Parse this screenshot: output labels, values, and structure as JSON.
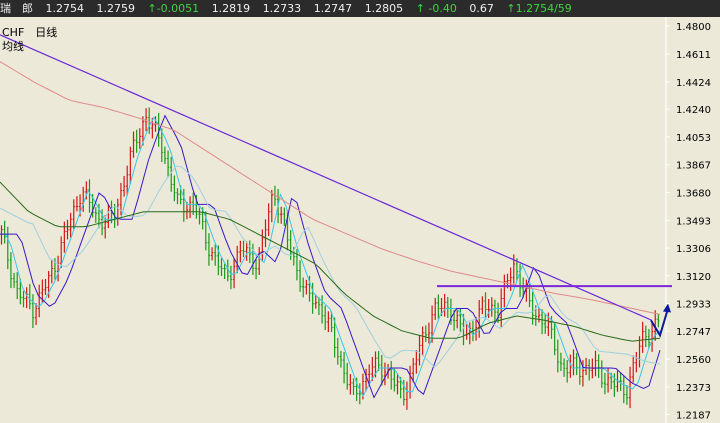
{
  "quote_bar": {
    "name": "瑞　郎",
    "fields": [
      "1.2754",
      "1.2759",
      "0.0051",
      "1.2819",
      "1.2733",
      "1.2747",
      "1.2805"
    ],
    "change_up": "↑-0.0051",
    "change_pct": "↑ -0.40",
    "extra": "0.67",
    "last": "↑1.2754/59"
  },
  "chart_info": {
    "symbol_period": "CHF　日线",
    "indicator": "均线"
  },
  "colors": {
    "background": "#ece9d8",
    "axis": "#ffffff",
    "candle_up": "#d01818",
    "candle_down": "#1a9a1a",
    "ma_fast": "#38c8e8",
    "ma_mid": "#3818c8",
    "ma_light": "#9fd0e0",
    "ma_slow": "#2a6a1a",
    "ma_long": "#e08a8a",
    "trendline": "#6a28d8",
    "resistance": "#7a28d8",
    "arrow": "#0a1a9a"
  },
  "chart_data": {
    "type": "candlestick",
    "title": "CHF 日线",
    "y_ticks": [
      "1.4800",
      "1.4611",
      "1.4424",
      "1.4240",
      "1.4053",
      "1.3867",
      "1.3680",
      "1.3493",
      "1.3306",
      "1.3120",
      "1.2933",
      "1.2747",
      "1.2560",
      "1.2373",
      "1.2187"
    ],
    "ylim": [
      1.213,
      1.486
    ],
    "close_path": [
      1.34,
      1.3,
      1.29,
      1.31,
      1.34,
      1.37,
      1.35,
      1.35,
      1.39,
      1.42,
      1.4,
      1.36,
      1.36,
      1.33,
      1.31,
      1.33,
      1.32,
      1.37,
      1.33,
      1.3,
      1.29,
      1.26,
      1.23,
      1.25,
      1.25,
      1.23,
      1.26,
      1.29,
      1.29,
      1.27,
      1.29,
      1.29,
      1.32,
      1.29,
      1.28,
      1.25,
      1.25,
      1.25,
      1.24,
      1.235,
      1.27,
      1.28
    ],
    "trendline": {
      "start": 1.474,
      "end": 1.282
    },
    "resistance_level": 1.305,
    "ma_slow_path": [
      1.375,
      1.355,
      1.345,
      1.345,
      1.35,
      1.355,
      1.355,
      1.355,
      1.35,
      1.34,
      1.33,
      1.32,
      1.3,
      1.285,
      1.275,
      1.27,
      1.27,
      1.28,
      1.285,
      1.282,
      1.278,
      1.272,
      1.268,
      1.27
    ],
    "ma_long_path": [
      1.456,
      1.442,
      1.43,
      1.425,
      1.418,
      1.41,
      1.395,
      1.38,
      1.365,
      1.35,
      1.34,
      1.33,
      1.322,
      1.315,
      1.31,
      1.305,
      1.3,
      1.296,
      1.291,
      1.286
    ],
    "arrow": [
      1.282,
      1.272,
      1.29
    ]
  }
}
